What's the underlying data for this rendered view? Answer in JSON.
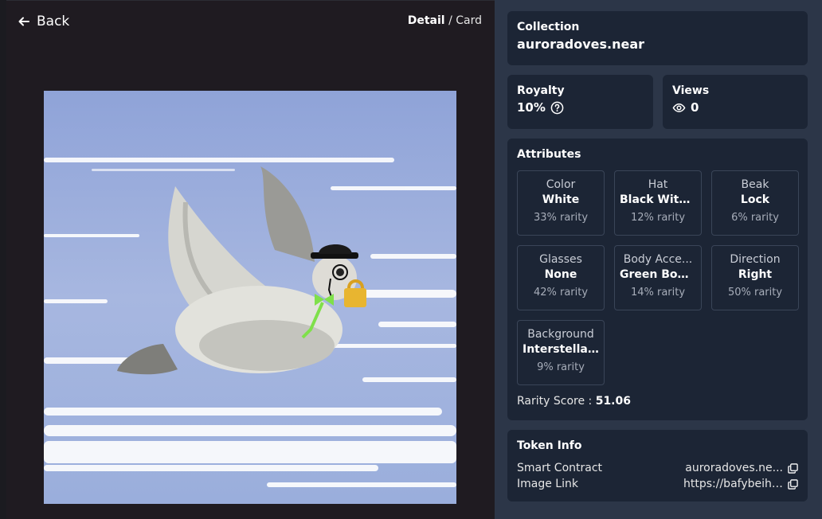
{
  "nav": {
    "back_label": "Back"
  },
  "breadcrumb": {
    "current": "Detail",
    "separator": "/",
    "next": "Card"
  },
  "colors": {
    "right_panel_bg": "#2c3648",
    "card_bg": "#1c2535",
    "sky": "#8da3d6",
    "bow": "#7fe04a",
    "lock": "#e8b530"
  },
  "collection": {
    "label": "Collection",
    "value": "auroradoves.near"
  },
  "royalty": {
    "label": "Royalty",
    "value": "10%"
  },
  "views": {
    "label": "Views",
    "value": "0"
  },
  "attributes": {
    "label": "Attributes",
    "items": [
      {
        "name": "Color",
        "value": "White",
        "rarity": "33% rarity"
      },
      {
        "name": "Hat",
        "value": "Black With ...",
        "rarity": "12% rarity"
      },
      {
        "name": "Beak",
        "value": "Lock",
        "rarity": "6% rarity"
      },
      {
        "name": "Glasses",
        "value": "None",
        "rarity": "42% rarity"
      },
      {
        "name": "Body Acce...",
        "value": "Green Bow...",
        "rarity": "14% rarity"
      },
      {
        "name": "Direction",
        "value": "Right",
        "rarity": "50% rarity"
      },
      {
        "name": "Background",
        "value": "Interstellar...",
        "rarity": "9% rarity"
      }
    ],
    "score_label": "Rarity Score :",
    "score_value": "51.06"
  },
  "token_info": {
    "label": "Token Info",
    "smart_contract_label": "Smart Contract",
    "smart_contract_value": "auroradoves.ne...",
    "image_link_label": "Image Link",
    "image_link_value": "https://bafybeihgxv..."
  }
}
